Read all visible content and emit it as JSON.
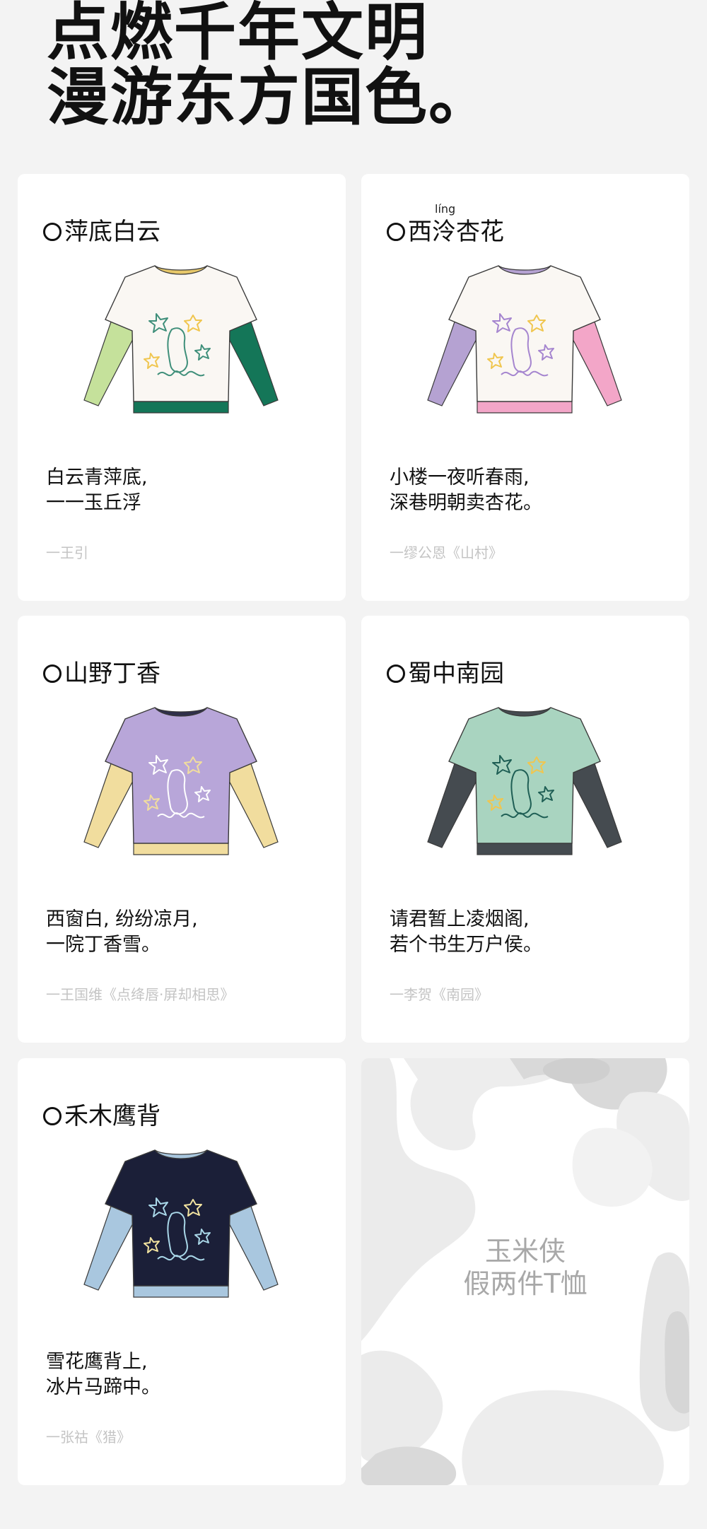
{
  "headline": {
    "line1": "点燃千年文明",
    "line2": "漫游东方国色。"
  },
  "cards": [
    {
      "title": "萍底白云",
      "ruby": "",
      "poem1": "白云青萍底,",
      "poem2": "一一玉丘浮",
      "source": "一王引",
      "colors": {
        "body": "#faf7f3",
        "left_sleeve": "#c5e19b",
        "right_sleeve": "#147658",
        "hem": "#147658",
        "collar": "#e7c86a",
        "art": "#3f8f7a",
        "art2": "#f0c64f"
      }
    },
    {
      "title": "西泠杏花",
      "ruby": "líng",
      "poem1": "小楼一夜听春雨,",
      "poem2": "深巷明朝卖杏花。",
      "source": "一缪公恩《山村》",
      "colors": {
        "body": "#faf7f3",
        "left_sleeve": "#b5a2d2",
        "right_sleeve": "#f3a6c8",
        "hem": "#f3a6c8",
        "collar": "#b5a2d2",
        "art": "#a585cf",
        "art2": "#f0c64f"
      }
    },
    {
      "title": "山野丁香",
      "ruby": "",
      "poem1": "西窗白, 纷纷凉月,",
      "poem2": "一院丁香雪。",
      "source": "一王国维《点绛唇·屏却相思》",
      "colors": {
        "body": "#b8a6d9",
        "left_sleeve": "#f1dd9e",
        "right_sleeve": "#f1dd9e",
        "hem": "#f1dd9e",
        "collar": "#2f2f4a",
        "art": "#ffffff",
        "art2": "#f1dd9e"
      }
    },
    {
      "title": "蜀中南园",
      "ruby": "",
      "poem1": "请君暂上凌烟阁,",
      "poem2": "若个书生万户侯。",
      "source": "一李贺《南园》",
      "colors": {
        "body": "#a9d4c0",
        "left_sleeve": "#454b50",
        "right_sleeve": "#454b50",
        "hem": "#454b50",
        "collar": "#454b50",
        "art": "#1f5f55",
        "art2": "#f0c64f"
      }
    },
    {
      "title": "禾木鹰背",
      "ruby": "",
      "poem1": "雪花鹰背上,",
      "poem2": "冰片马蹄中。",
      "source": "一张祜《猎》",
      "colors": {
        "body": "#1b1f38",
        "left_sleeve": "#a9c7df",
        "right_sleeve": "#a9c7df",
        "hem": "#a9c7df",
        "collar": "#a9c7df",
        "art": "#a9d7e8",
        "art2": "#f2e3a0"
      }
    }
  ],
  "promo": {
    "line1": "玉米侠",
    "line2": "假两件T恤"
  }
}
